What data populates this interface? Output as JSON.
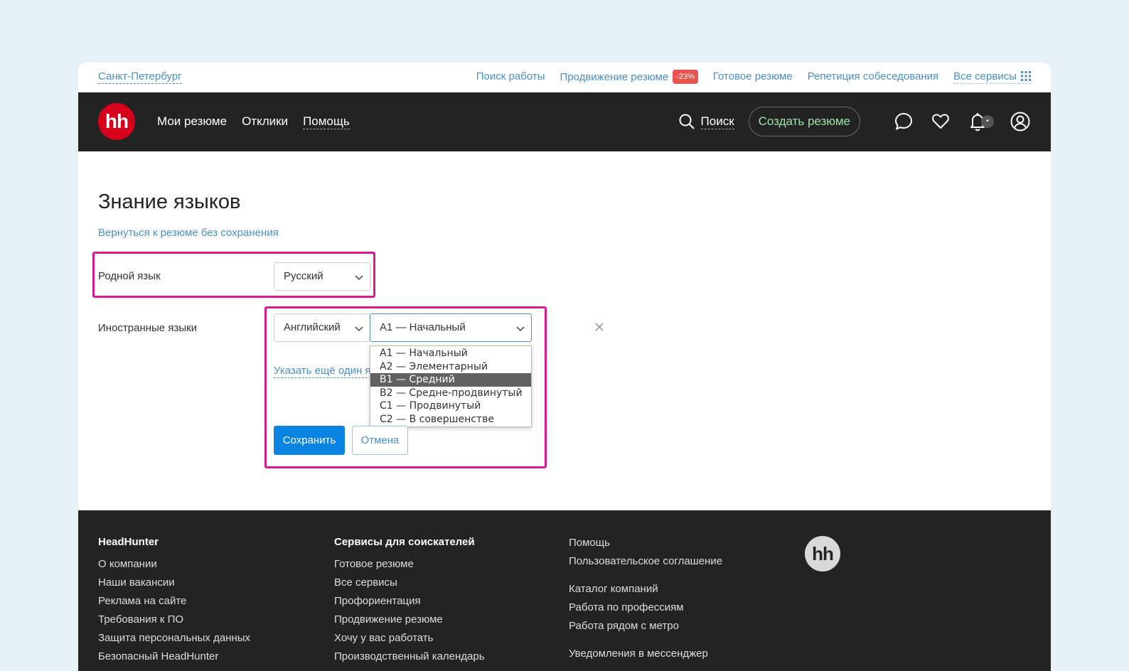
{
  "topbar": {
    "city": "Санкт-Петербург",
    "links": [
      "Поиск работы",
      "Продвижение резюме",
      "Готовое резюме",
      "Репетиция собеседования"
    ],
    "promo_badge": "-23%",
    "all_services": "Все сервисы"
  },
  "header": {
    "logo": "hh",
    "nav": [
      "Мои резюме",
      "Отклики",
      "Помощь"
    ],
    "search_label": "Поиск",
    "create_resume": "Создать резюме",
    "notification_dot": "•"
  },
  "form": {
    "title": "Знание языков",
    "back_link": "Вернуться к резюме без сохранения",
    "native_label": "Родной язык",
    "native_value": "Русский",
    "foreign_label": "Иностранные языки",
    "foreign_language": "Английский",
    "foreign_level": "A1 — Начальный",
    "level_options": [
      "A1 — Начальный",
      "A2 — Элементарный",
      "B1 — Средний",
      "B2 — Средне-продвинутый",
      "C1 — Продвинутый",
      "C2 — В совершенстве"
    ],
    "highlighted_option": "B1 — Средний",
    "add_more": "Указать ещё один язык",
    "save": "Сохранить",
    "cancel": "Отмена"
  },
  "footer": {
    "col1": {
      "heading": "HeadHunter",
      "items": [
        "О компании",
        "Наши вакансии",
        "Реклама на сайте",
        "Требования к ПО",
        "Защита персональных данных",
        "Безопасный HeadHunter"
      ]
    },
    "col2": {
      "heading": "Сервисы для соискателей",
      "items": [
        "Готовое резюме",
        "Все сервисы",
        "Профориентация",
        "Продвижение резюме",
        "Хочу у вас работать",
        "Производственный календарь"
      ]
    },
    "col3": {
      "group1": [
        "Помощь",
        "Пользовательское соглашение"
      ],
      "group2": [
        "Каталог компаний",
        "Работа по профессиям",
        "Работа рядом с метро"
      ],
      "group3": [
        "Уведомления в мессенджер"
      ]
    },
    "logo": "hh"
  },
  "colors": {
    "brand_red": "#d6001c",
    "link_blue": "#4a8fcc",
    "primary_button": "#0a84e0",
    "highlight_frame": "#d81b8e",
    "dark_bg": "#232323"
  }
}
